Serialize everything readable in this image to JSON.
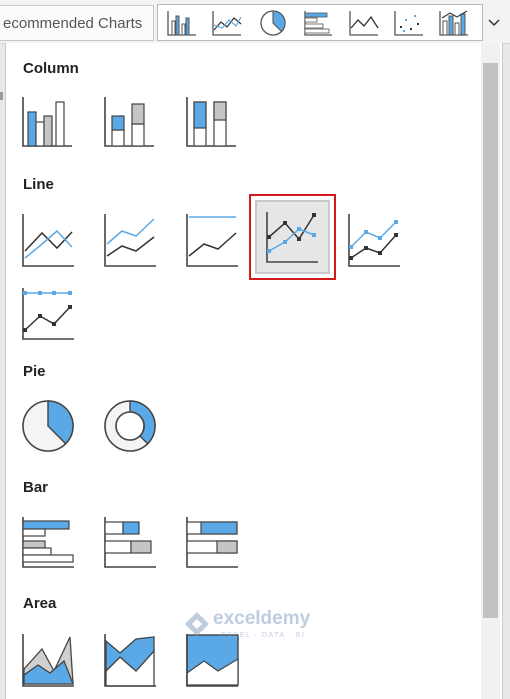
{
  "ribbon": {
    "recommended_label": "ecommended Charts"
  },
  "gallery_strip": {
    "items": [
      {
        "icon": "column-chart-icon"
      },
      {
        "icon": "line-chart-icon"
      },
      {
        "icon": "pie-chart-icon"
      },
      {
        "icon": "bar-chart-icon"
      },
      {
        "icon": "area-chart-icon"
      },
      {
        "icon": "scatter-chart-icon"
      },
      {
        "icon": "combo-chart-icon"
      }
    ],
    "dropdown_icon": "chevron-down-icon"
  },
  "sections": {
    "column": {
      "title": "Column"
    },
    "line": {
      "title": "Line"
    },
    "pie": {
      "title": "Pie"
    },
    "bar": {
      "title": "Bar"
    },
    "area": {
      "title": "Area"
    }
  },
  "selected_item": "line-with-markers",
  "watermark": {
    "title": "exceldemy",
    "subtitle": "EXCEL · DATA · BI"
  },
  "colors": {
    "accent_blue": "#5aa9e6",
    "dark_line": "#3a3a3a",
    "gray_fill": "#c5c5c5",
    "selection_red": "#d21a1a"
  }
}
